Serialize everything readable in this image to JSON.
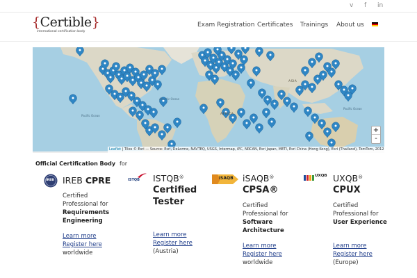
{
  "topbar": {
    "social": [
      {
        "name": "twitter",
        "glyph": "v"
      },
      {
        "name": "facebook",
        "glyph": "f"
      },
      {
        "name": "linkedin",
        "glyph": "in"
      }
    ]
  },
  "header": {
    "logo_text": "Certible",
    "logo_brace_open": "{",
    "logo_brace_close": "}",
    "logo_tagline": "international certification body",
    "nav": [
      "Exam Registration",
      "Certificates",
      "Trainings",
      "About us"
    ],
    "language_flag": "de"
  },
  "map": {
    "labels": [
      "Atlantic Ocean",
      "Pacific Ocean",
      "AFRICA",
      "ASIA",
      "Pacific Ocean"
    ],
    "zoom_in": "+",
    "zoom_out": "-",
    "attribution_link": "Leaflet",
    "attribution_text": " | Tiles © Esri — Source: Esri, DeLorme, NAVTEQ, USGS, Intermap, iPC, NRCAN, Esri Japan, METI, Esri China (Hong Kong), Esri (Thailand), TomTom, 2012",
    "colors": {
      "water": "#a6cfe3",
      "land": "#dcd8c7",
      "marker": "#2f86c4"
    }
  },
  "certs_section": {
    "title": "Official Certification Body",
    "for_label": "for",
    "certs": [
      {
        "logo": "IREB",
        "name": "IREB",
        "name_strong": "CPRE",
        "desc": [
          "Certified",
          "Professional for"
        ],
        "desc_bold": [
          "Requirements",
          "Engineering"
        ],
        "learn_more": "Learn more",
        "register": "Register here",
        "region": "worldwide"
      },
      {
        "logo": "ISTQB",
        "name": "ISTQB",
        "reg_mark": "®",
        "name_strong_lines": [
          "Certified",
          "Tester"
        ],
        "learn_more": "Learn more",
        "register": "Register here",
        "region": "(Austria)"
      },
      {
        "logo": "iSAQB",
        "name": "iSAQB",
        "reg_mark": "®",
        "name_strong": "CPSA®",
        "desc": [
          "Certified",
          "Professional for"
        ],
        "desc_bold": [
          "Software",
          "Architecture"
        ],
        "learn_more": "Learn more",
        "register": "Register here",
        "region": "worldwide"
      },
      {
        "logo": "UXQB",
        "name": "UXQB",
        "reg_mark": "®",
        "name_strong": "CPUX",
        "desc": [
          "Certified",
          "Professional for"
        ],
        "desc_bold": [
          "User Experience"
        ],
        "learn_more": "Learn more",
        "register": "Register here",
        "region": "(Europe)"
      }
    ]
  }
}
